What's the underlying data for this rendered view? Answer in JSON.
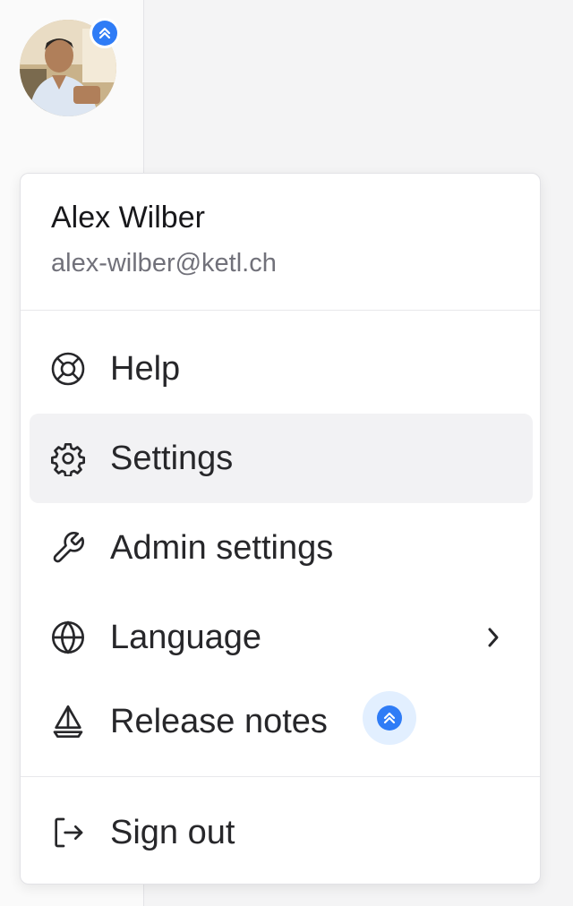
{
  "user": {
    "name": "Alex Wilber",
    "email": "alex-wilber@ketl.ch",
    "has_update_badge": true
  },
  "menu": {
    "items": [
      {
        "label": "Help",
        "icon": "lifebuoy-icon",
        "active": false
      },
      {
        "label": "Settings",
        "icon": "gear-icon",
        "active": true
      },
      {
        "label": "Admin settings",
        "icon": "wrench-icon",
        "active": false
      },
      {
        "label": "Language",
        "icon": "globe-icon",
        "active": false,
        "has_submenu": true
      },
      {
        "label": "Release notes",
        "icon": "sailboat-icon",
        "active": false,
        "has_badge": true
      }
    ],
    "sign_out": {
      "label": "Sign out",
      "icon": "sign-out-icon"
    }
  },
  "colors": {
    "badge_blue": "#2f7cf6",
    "badge_bg": "#e2efff",
    "active_bg": "#f2f2f4",
    "text": "#27272a",
    "muted_text": "#71717a"
  }
}
